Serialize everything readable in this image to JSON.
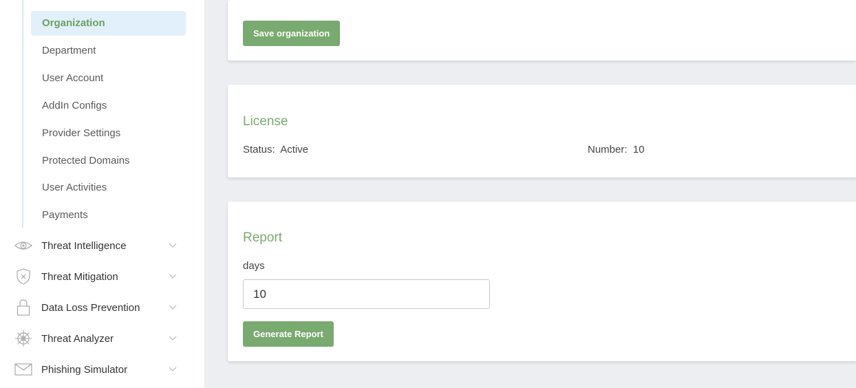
{
  "sidebar": {
    "subitems": [
      {
        "label": "Organization",
        "active": true
      },
      {
        "label": "Department"
      },
      {
        "label": "User Account"
      },
      {
        "label": "AddIn Configs"
      },
      {
        "label": "Provider Settings"
      },
      {
        "label": "Protected Domains"
      },
      {
        "label": "User Activities"
      },
      {
        "label": "Payments"
      }
    ],
    "groups": [
      {
        "label": "Threat Intelligence",
        "icon": "eye-icon"
      },
      {
        "label": "Threat Mitigation",
        "icon": "shield-x-icon"
      },
      {
        "label": "Data Loss Prevention",
        "icon": "lock-icon"
      },
      {
        "label": "Threat Analyzer",
        "icon": "ship-wheel-icon"
      },
      {
        "label": "Phishing Simulator",
        "icon": "envelope-icon"
      }
    ]
  },
  "organization_card": {
    "save_label": "Save organization"
  },
  "license": {
    "title": "License",
    "status_label": "Status:",
    "status_value": "Active",
    "number_label": "Number:",
    "number_value": "10"
  },
  "report": {
    "title": "Report",
    "days_label": "days",
    "days_value": "10",
    "generate_label": "Generate Report"
  },
  "colors": {
    "accent": "#79aa6f",
    "active_bg": "#e1f0fb",
    "page_bg": "#eceef1"
  }
}
